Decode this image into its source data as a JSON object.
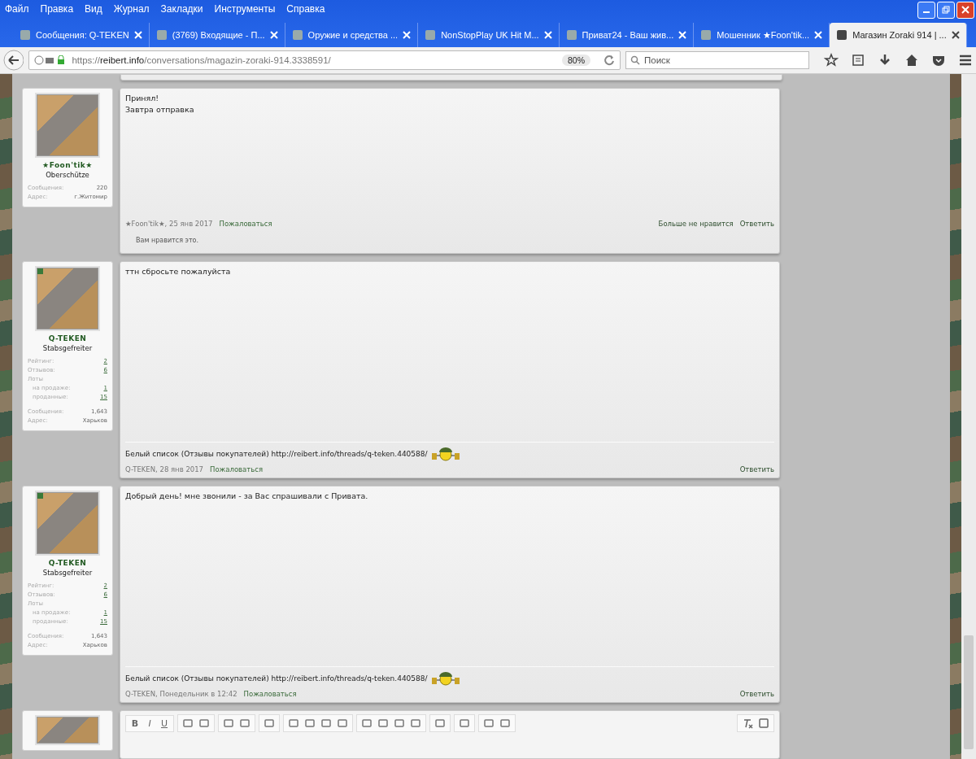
{
  "menu": [
    "Файл",
    "Правка",
    "Вид",
    "Журнал",
    "Закладки",
    "Инструменты",
    "Справка"
  ],
  "tabs": [
    {
      "label": "Сообщения: Q-TEKEN",
      "selected": false
    },
    {
      "label": "(3769) Входящие - П...",
      "selected": false
    },
    {
      "label": "Оружие и средства ...",
      "selected": false
    },
    {
      "label": "NonStopPlay UK Hit M...",
      "selected": false
    },
    {
      "label": "Приват24 - Ваш жив...",
      "selected": false
    },
    {
      "label": "Мошенник ★Foon'tik...",
      "selected": false
    },
    {
      "label": "Магазин Zoraki 914 | ...",
      "selected": true
    }
  ],
  "address": {
    "scheme": "https://",
    "domain": "reibert.info",
    "path": "/conversations/magazin-zoraki-914.3338591/",
    "zoom": "80%"
  },
  "search": {
    "placeholder": "Поиск"
  },
  "posts": [
    {
      "user": {
        "name": "★Foon'tik★",
        "rank": "Oberschütze",
        "online": false,
        "stats": [
          {
            "label": "Сообщения:",
            "value": "220",
            "kind": "text"
          },
          {
            "label": "Адрес:",
            "value": "г.Житомир",
            "kind": "text"
          }
        ]
      },
      "message": [
        "Принял!",
        "Завтра отправка"
      ],
      "author": "★Foon'tik★, 25 янв 2017",
      "report": "Пожаловаться",
      "actions": [
        "Больше не нравится",
        "Ответить"
      ],
      "likes": "Вам нравится это."
    },
    {
      "user": {
        "name": "Q-TEKEN",
        "rank": "Stabsgefreiter",
        "online": true,
        "stats": [
          {
            "label": "Рейтинг:",
            "value": "2",
            "kind": "link"
          },
          {
            "label": "Отзывов:",
            "value": "6",
            "kind": "link"
          },
          {
            "label": "Лоты",
            "kind": "group",
            "children": [
              {
                "label": "на продаже:",
                "value": "1",
                "kind": "link"
              },
              {
                "label": "проданные:",
                "value": "15",
                "kind": "link"
              }
            ]
          },
          {
            "label": "Сообщения:",
            "value": "1,643",
            "kind": "text"
          },
          {
            "label": "Адрес:",
            "value": "Харьков",
            "kind": "text"
          }
        ]
      },
      "message": [
        "ттн сбросьте пожалуйста"
      ],
      "signature": "Белый список (Отзывы покупателей) http://reibert.info/threads/q-teken.440588/",
      "author": "Q-TEKEN, 28 янв 2017",
      "report": "Пожаловаться",
      "actions": [
        "Ответить"
      ]
    },
    {
      "user": {
        "name": "Q-TEKEN",
        "rank": "Stabsgefreiter",
        "online": true,
        "stats": [
          {
            "label": "Рейтинг:",
            "value": "2",
            "kind": "link"
          },
          {
            "label": "Отзывов:",
            "value": "6",
            "kind": "link"
          },
          {
            "label": "Лоты",
            "kind": "group",
            "children": [
              {
                "label": "на продаже:",
                "value": "1",
                "kind": "link"
              },
              {
                "label": "проданные:",
                "value": "15",
                "kind": "link"
              }
            ]
          },
          {
            "label": "Сообщения:",
            "value": "1,643",
            "kind": "text"
          },
          {
            "label": "Адрес:",
            "value": "Харьков",
            "kind": "text"
          }
        ]
      },
      "message": [
        "Добрый день! мне звонили - за Вас спрашивали с Привата."
      ],
      "signature": "Белый список (Отзывы покупателей) http://reibert.info/threads/q-teken.440588/",
      "author": "Q-TEKEN, Понедельник в 12:42",
      "report": "Пожаловаться",
      "actions": [
        "Ответить"
      ]
    }
  ],
  "editor": {
    "format_buttons": [
      "B",
      "I",
      "U"
    ]
  }
}
